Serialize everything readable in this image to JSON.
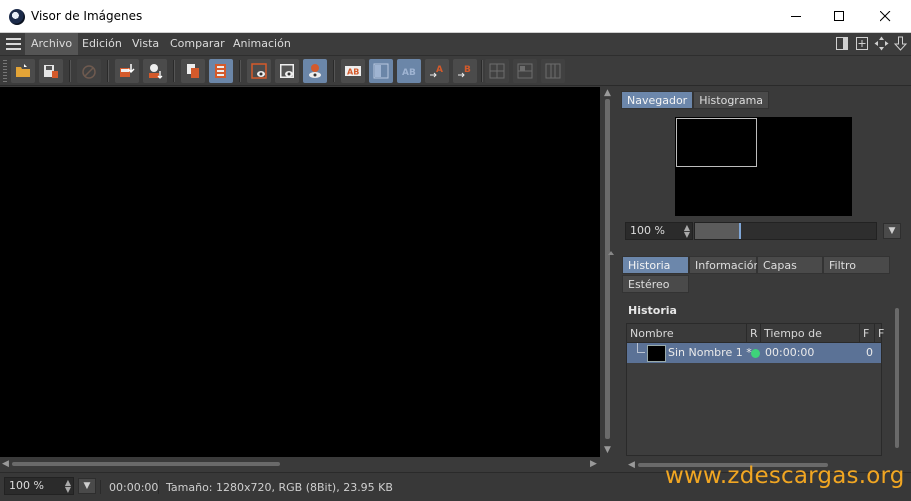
{
  "window": {
    "title": "Visor de Imágenes",
    "buttons": [
      "minimize",
      "maximize",
      "close"
    ]
  },
  "menu": {
    "items": [
      "Archivo",
      "Edición",
      "Vista",
      "Comparar",
      "Animación"
    ],
    "active": "Archivo",
    "right_icons": [
      "panel-icon",
      "add-panel-icon",
      "move-icon",
      "download-icon"
    ]
  },
  "toolbar": {
    "icons": [
      "open-folder-icon",
      "save-icon",
      "stop-icon",
      "render-add-icon",
      "user-download-icon",
      "copy-layer-icon",
      "book-icon",
      "view-frame-icon",
      "view-region-icon",
      "view-people-icon",
      "ab-icon",
      "compare-left-icon",
      "compare-ab-icon",
      "arrow-a-icon",
      "arrow-b-icon",
      "grid-icon-1",
      "grid-icon-2",
      "grid-icon-3"
    ]
  },
  "navigator": {
    "tabs": [
      "Navegador",
      "Histograma"
    ],
    "active_tab": "Navegador",
    "zoom": "100 %"
  },
  "lower_panel": {
    "tabs": [
      "Historia",
      "Información",
      "Capas",
      "Filtro",
      "Estéreo"
    ],
    "active_tab": "Historia",
    "section_title": "Historia",
    "columns": [
      "Nombre",
      "R",
      "Tiempo de Render",
      "F",
      "F"
    ],
    "rows": [
      {
        "name": "Sin Nombre 1 *",
        "status_color": "#3ed37a",
        "time": "00:00:00",
        "frame": "0"
      }
    ]
  },
  "status": {
    "zoom": "100 %",
    "time": "00:00:00",
    "info": "Tamaño: 1280x720, RGB (8Bit), 23.95 KB"
  },
  "watermark": "www.zdescargas.org",
  "colors": {
    "accent": "#6c87ab",
    "background": "#3a3a3a",
    "viewport": "#000000",
    "watermark": "#f1a622"
  }
}
